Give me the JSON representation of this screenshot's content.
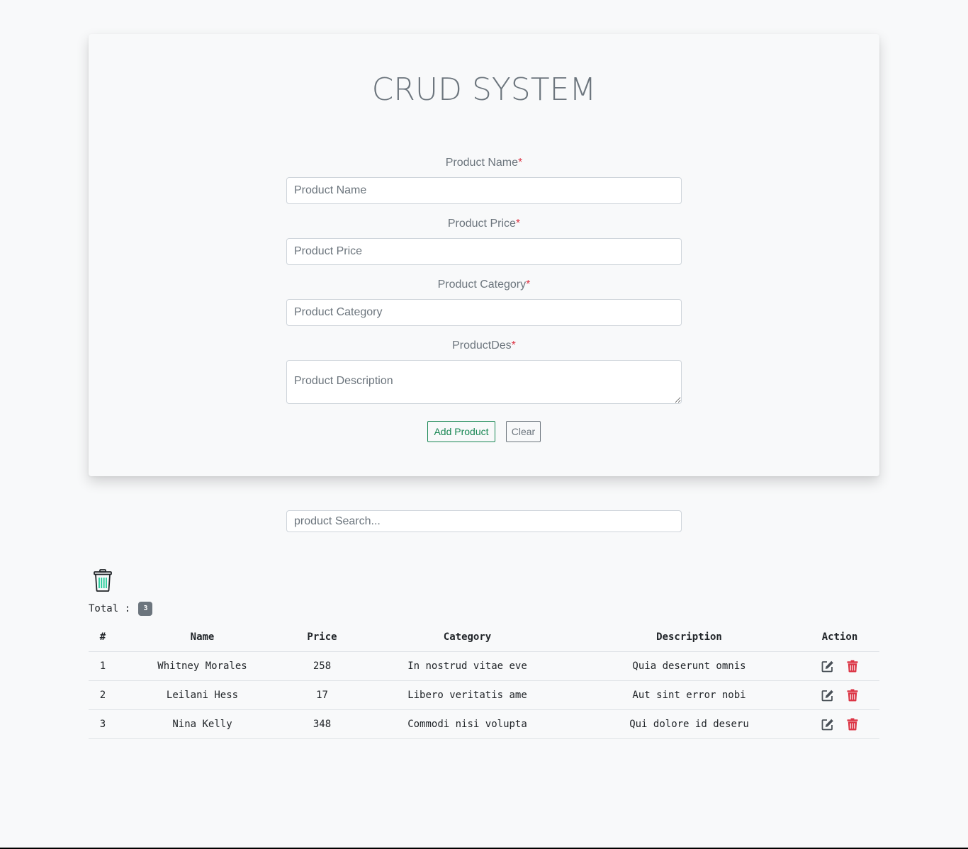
{
  "header": {
    "title": "CRUD SYSTEM"
  },
  "form": {
    "name": {
      "label": "Product Name",
      "required_mark": "*",
      "placeholder": "Product Name",
      "value": ""
    },
    "price": {
      "label": "Product Price",
      "required_mark": "*",
      "placeholder": "Product Price",
      "value": ""
    },
    "category": {
      "label": "Product Category",
      "required_mark": "*",
      "placeholder": "Product Category",
      "value": ""
    },
    "description": {
      "label": "ProductDes",
      "required_mark": "*",
      "placeholder": "Product Description",
      "value": ""
    },
    "add_label": "Add Product",
    "clear_label": "Clear"
  },
  "search": {
    "placeholder": "product Search...",
    "value": ""
  },
  "summary": {
    "delete_all_icon": "trash-icon",
    "total_label": "Total :",
    "total_count": "3"
  },
  "table": {
    "columns": [
      "#",
      "Name",
      "Price",
      "Category",
      "Description",
      "Action"
    ],
    "rows": [
      {
        "index": "1",
        "name": "Whitney Morales",
        "price": "258",
        "category": "In nostrud vitae eve",
        "description": "Quia deserunt omnis"
      },
      {
        "index": "2",
        "name": "Leilani Hess",
        "price": "17",
        "category": "Libero veritatis ame",
        "description": "Aut sint error nobi"
      },
      {
        "index": "3",
        "name": "Nina Kelly",
        "price": "348",
        "category": "Commodi nisi volupta",
        "description": "Qui dolore id deseru"
      }
    ],
    "action_icons": {
      "edit": "edit-icon",
      "delete": "trash-icon"
    }
  },
  "colors": {
    "background": "#f8f9fa",
    "title": "#6c757d",
    "required": "#dc3545",
    "add_button": "#198754",
    "clear_button": "#6c757d",
    "delete_icon": "#dc3545",
    "edit_icon": "#495057",
    "badge": "#6c757d",
    "big_trash_outline": "#212529",
    "big_trash_stripes": "#20c997"
  }
}
